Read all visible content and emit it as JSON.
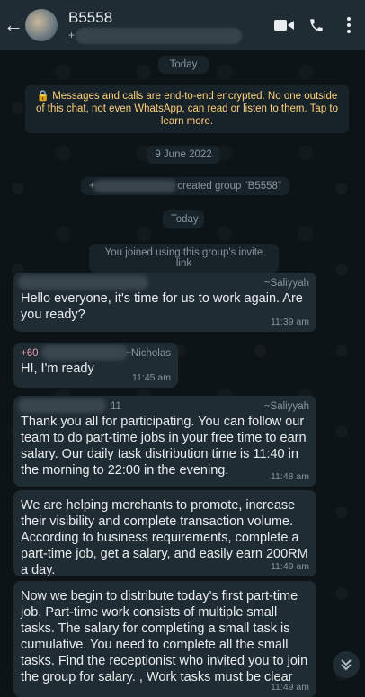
{
  "header": {
    "back_glyph": "←",
    "title": "B5558",
    "subtitle_prefix": "+",
    "icons": [
      "back-arrow-icon",
      "video-call-icon",
      "voice-call-icon",
      "more-vert-icon"
    ]
  },
  "chat": {
    "pill_today_top": "Today",
    "encryption_notice": "🔒 Messages and calls are end-to-end encrypted. No one outside of this chat, not even WhatsApp, can read or listen to them. Tap to learn more.",
    "date_pill": "9 June 2022",
    "created_group": "created group \"B5558\"",
    "created_prefix": "+",
    "pill_today": "Today",
    "joined": "You joined using this group's invite link",
    "messages": [
      {
        "sender_name": "~Saliyyah",
        "sender_number": "",
        "text": "Hello everyone, it's time for us to work again. Are you ready?",
        "time": "11:39 am"
      },
      {
        "sender_name": "~Nicholas",
        "sender_number": "+60",
        "text": "HI, I'm ready",
        "time": "11:45 am"
      },
      {
        "sender_name": "~Saliyyah",
        "sender_number": "11",
        "text": "Thank you all for participating. You can follow our team to do part-time jobs in your free time to earn salary. Our daily task distribution time is 11:40 in the morning to 22:00 in the evening.",
        "time": "11:48 am"
      },
      {
        "sender_name": "",
        "sender_number": "",
        "text": "We are helping merchants to promote, increase their visibility and complete transaction volume. According to business requirements, complete a part-time job, get a salary, and easily earn 200RM a day.",
        "time": "11:49 am"
      },
      {
        "sender_name": "",
        "sender_number": "",
        "text": "Now we begin to distribute today's first part-time job. Part-time work consists of multiple small tasks. The salary for completing a small task is cumulative. You need to complete all the small tasks. Find the receptionist who invited you to join the group for salary. , Work tasks must be clear",
        "time": "11:49 am"
      }
    ]
  },
  "scroll_button": {
    "icon": "double-chevron-down-icon"
  }
}
